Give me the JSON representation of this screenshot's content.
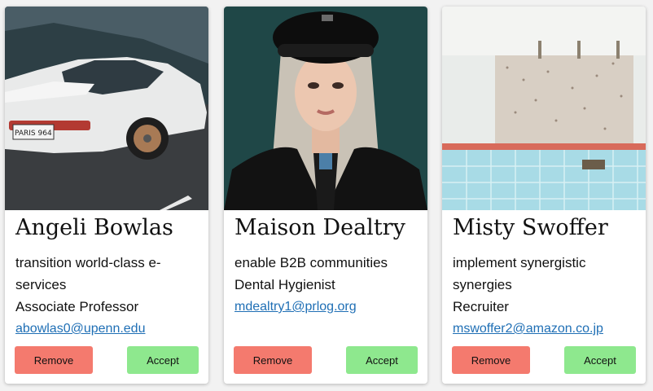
{
  "cards": [
    {
      "name": "Angeli Bowlas",
      "description": "transition world-class e-services",
      "job_title": "Associate Professor",
      "email": "abowlas0@upenn.edu",
      "plate": "PARIS 964",
      "remove_label": "Remove",
      "accept_label": "Accept"
    },
    {
      "name": "Maison Dealtry",
      "description": "enable B2B communities",
      "job_title": "Dental Hygienist",
      "email": "mdealtry1@prlog.org",
      "remove_label": "Remove",
      "accept_label": "Accept"
    },
    {
      "name": "Misty Swoffer",
      "description": "implement synergistic synergies",
      "job_title": "Recruiter",
      "email": "mswoffer2@amazon.co.jp",
      "remove_label": "Remove",
      "accept_label": "Accept"
    }
  ],
  "colors": {
    "remove_button": "#f47a6e",
    "accept_button": "#8ee88e",
    "email_link": "#1f6fb5"
  }
}
